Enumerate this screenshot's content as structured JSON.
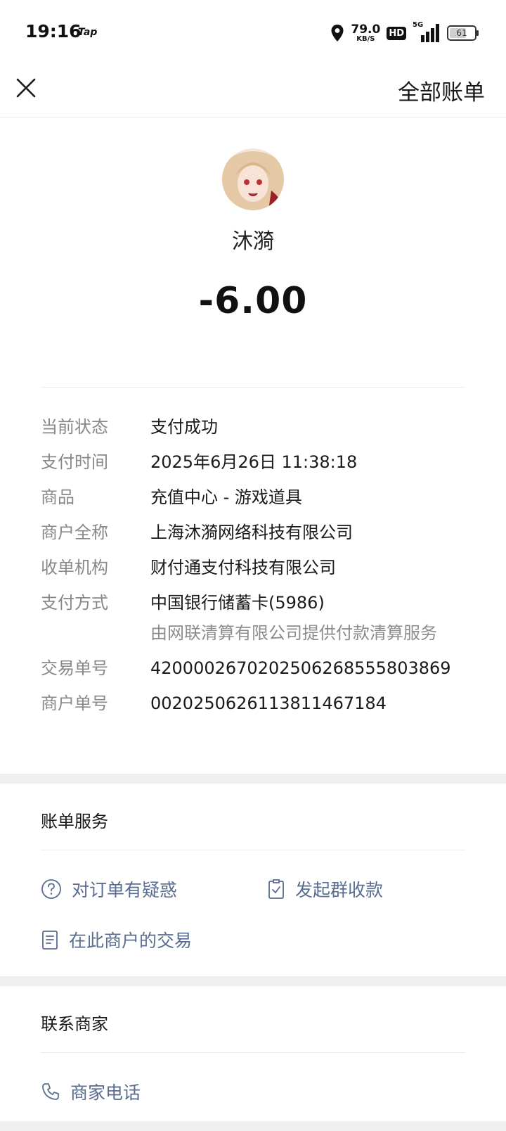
{
  "status_bar": {
    "time": "19:16",
    "app_tag": "Tap",
    "speed_value": "79.0",
    "speed_unit": "KB/S",
    "hd": "HD",
    "network": "5G",
    "battery": "61"
  },
  "nav": {
    "all_bills": "全部账单"
  },
  "header": {
    "merchant_name": "沐漪",
    "amount": "-6.00"
  },
  "details": [
    {
      "label": "当前状态",
      "value": "支付成功"
    },
    {
      "label": "支付时间",
      "value": "2025年6月26日 11:38:18"
    },
    {
      "label": "商品",
      "value": "充值中心 - 游戏道具"
    },
    {
      "label": "商户全称",
      "value": "上海沐漪网络科技有限公司"
    },
    {
      "label": "收单机构",
      "value": "财付通支付科技有限公司"
    },
    {
      "label": "支付方式",
      "value": "中国银行储蓄卡(5986)",
      "sub": "由网联清算有限公司提供付款清算服务"
    },
    {
      "label": "交易单号",
      "value": "4200002670202506268555803869"
    },
    {
      "label": "商户单号",
      "value": "0020250626113811467184"
    }
  ],
  "bill_service": {
    "title": "账单服务",
    "question": "对订单有疑惑",
    "group_collect": "发起群收款",
    "merchant_trades": "在此商户的交易"
  },
  "contact": {
    "title": "联系商家",
    "phone": "商家电话"
  },
  "colors": {
    "link": "#5a6c8f",
    "label": "#888888",
    "divider": "#efefef"
  }
}
